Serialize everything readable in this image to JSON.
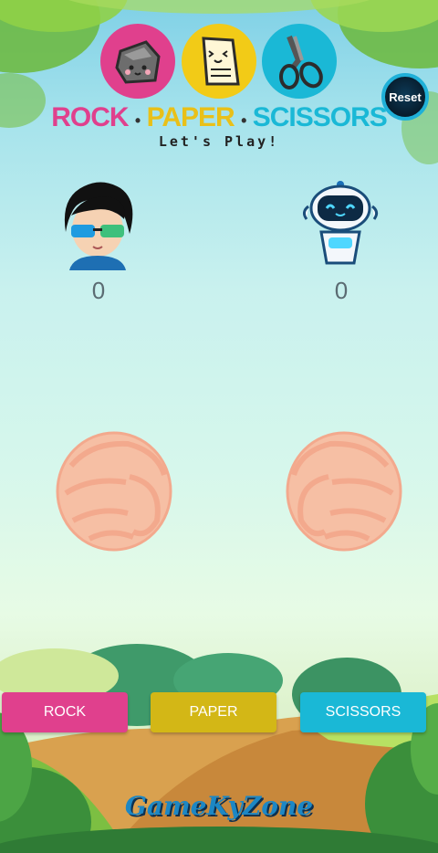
{
  "header": {
    "title_parts": [
      "ROCK",
      "PAPER",
      "SCISSORS"
    ],
    "title_colors": [
      "#e0408d",
      "#e9c018",
      "#1ab8d6"
    ],
    "separator": "•",
    "subtitle": "Let's Play!"
  },
  "reset_button": {
    "label": "Reset"
  },
  "players": {
    "human": {
      "score": "0"
    },
    "robot": {
      "score": "0"
    }
  },
  "choices": {
    "rock": {
      "label": "ROCK",
      "color": "#e0408d"
    },
    "paper": {
      "label": "PAPER",
      "color": "#d3b716"
    },
    "scissors": {
      "label": "SCISSORS",
      "color": "#1ab8d6"
    }
  },
  "brand": {
    "text": "GameKyZone"
  }
}
